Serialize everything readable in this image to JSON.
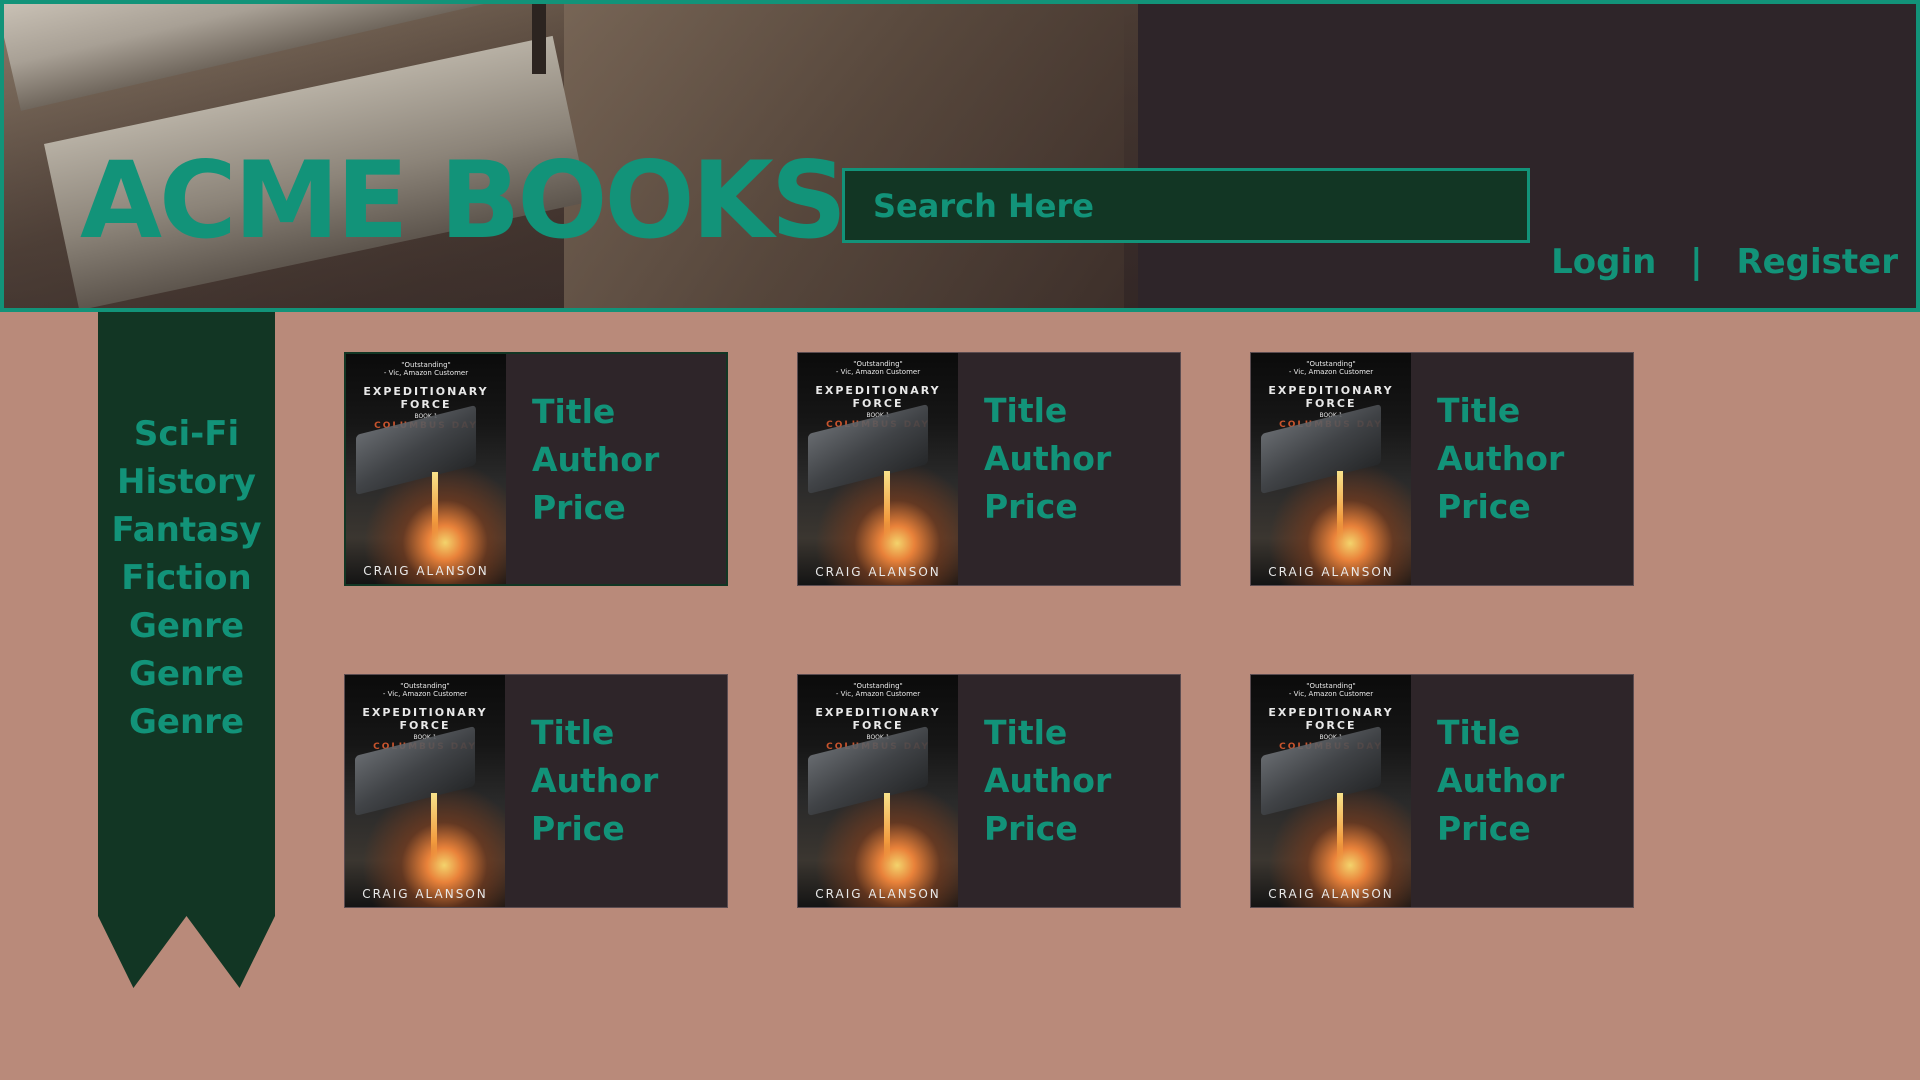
{
  "header": {
    "logo": "ACME BOOKS",
    "search_placeholder": "Search Here",
    "login": "Login",
    "separator": "|",
    "register": "Register"
  },
  "sidebar": {
    "genres": [
      "Sci-Fi",
      "History",
      "Fantasy",
      "Fiction",
      "Genre",
      "Genre",
      "Genre"
    ]
  },
  "books": [
    {
      "title": "Title",
      "author": "Author",
      "price": "Price"
    },
    {
      "title": "Title",
      "author": "Author",
      "price": "Price"
    },
    {
      "title": "Title",
      "author": "Author",
      "price": "Price"
    },
    {
      "title": "Title",
      "author": "Author",
      "price": "Price"
    },
    {
      "title": "Title",
      "author": "Author",
      "price": "Price"
    },
    {
      "title": "Title",
      "author": "Author",
      "price": "Price"
    }
  ],
  "cover": {
    "quote": "\"Outstanding\"",
    "quote_source": "- Vic, Amazon Customer",
    "series_line1": "EXPEDITIONARY",
    "series_line2": "FORCE",
    "book_number": "BOOK 1",
    "subtitle": "COLUMBUS DAY",
    "author": "CRAIG ALANSON"
  },
  "colors": {
    "accent": "#129379",
    "dark_green": "#123624",
    "card_bg": "#2e2529",
    "page_bg": "#b98a7a"
  }
}
